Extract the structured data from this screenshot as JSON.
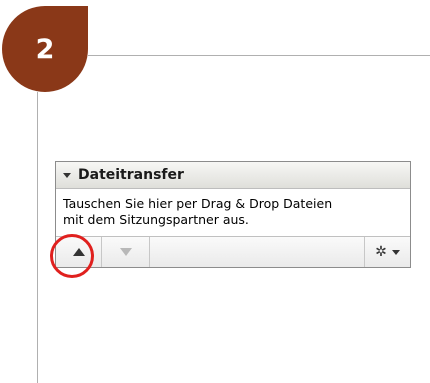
{
  "step": {
    "number": "2",
    "color": "#8a3818"
  },
  "panel": {
    "title": "Dateitransfer",
    "description_line1": "Tauschen Sie hier per Drag & Drop Dateien",
    "description_line2": "mit dem Sitzungspartner aus.",
    "toolbar": {
      "upload_icon": "arrow-up-icon",
      "download_icon": "arrow-down-icon",
      "settings_icon": "gear-icon"
    }
  },
  "highlight": {
    "color": "#e0201e",
    "target": "upload-button"
  }
}
